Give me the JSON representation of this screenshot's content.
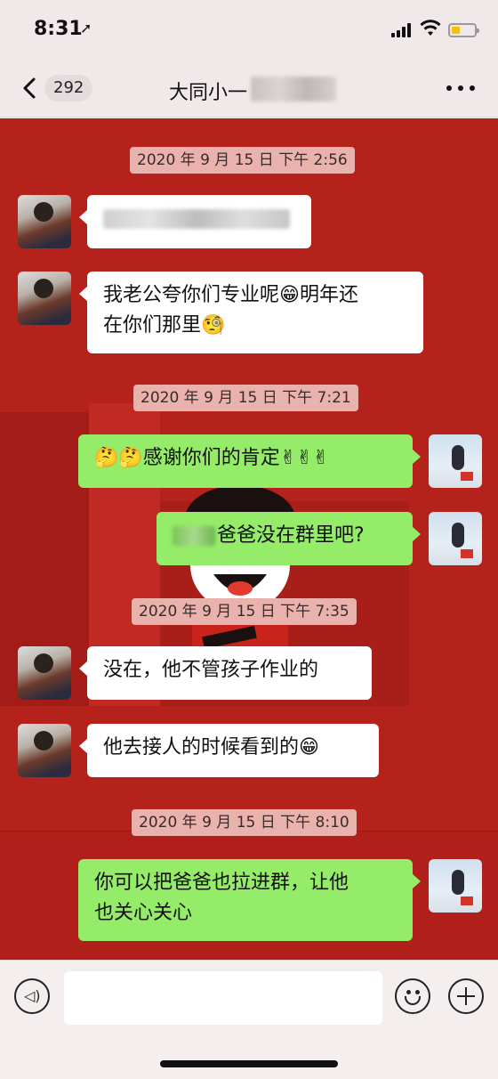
{
  "status_bar": {
    "time": "8:31",
    "location_icon": "location-arrow-icon",
    "battery_color": "#f2c300"
  },
  "nav": {
    "back_icon": "chevron-left-icon",
    "unread_count": "292",
    "title": "大同小一",
    "more_icon": "more-dots-icon"
  },
  "messages": [
    {
      "type": "timestamp",
      "text": "2020 年 9 月 15 日 下午 2:56"
    },
    {
      "type": "incoming",
      "text": "",
      "redacted": true
    },
    {
      "type": "incoming",
      "text_a": "我老公夸你们专业呢",
      "emoji_a": "😁",
      "text_b": "明年还",
      "text_c": "在你们那里",
      "emoji_b": "🧐"
    },
    {
      "type": "timestamp",
      "text": "2020 年 9 月 15 日 下午 7:21"
    },
    {
      "type": "outgoing",
      "emoji_a": "🤔🤔",
      "text": "感谢你们的肯定",
      "emoji_b": "✌✌✌"
    },
    {
      "type": "outgoing",
      "text": "爸爸没在群里吧?"
    },
    {
      "type": "timestamp",
      "text": "2020 年 9 月 15 日 下午 7:35"
    },
    {
      "type": "incoming",
      "text": "没在，他不管孩子作业的"
    },
    {
      "type": "incoming",
      "text": "他去接人的时候看到的",
      "emoji": "😁"
    },
    {
      "type": "timestamp",
      "text": "2020 年 9 月 15 日 下午 8:10"
    },
    {
      "type": "outgoing",
      "text_a": "你可以把爸爸也拉进群，让他",
      "text_b": "也关心关心"
    }
  ],
  "colors": {
    "chat_background": "#b5221c",
    "outgoing_bubble": "#95ec69",
    "incoming_bubble": "#ffffff",
    "timestamp_chip": "#e9b2ad"
  },
  "input_bar": {
    "voice_icon": "voice-icon",
    "emoji_icon": "emoji-face-icon",
    "plus_icon": "plus-icon"
  }
}
